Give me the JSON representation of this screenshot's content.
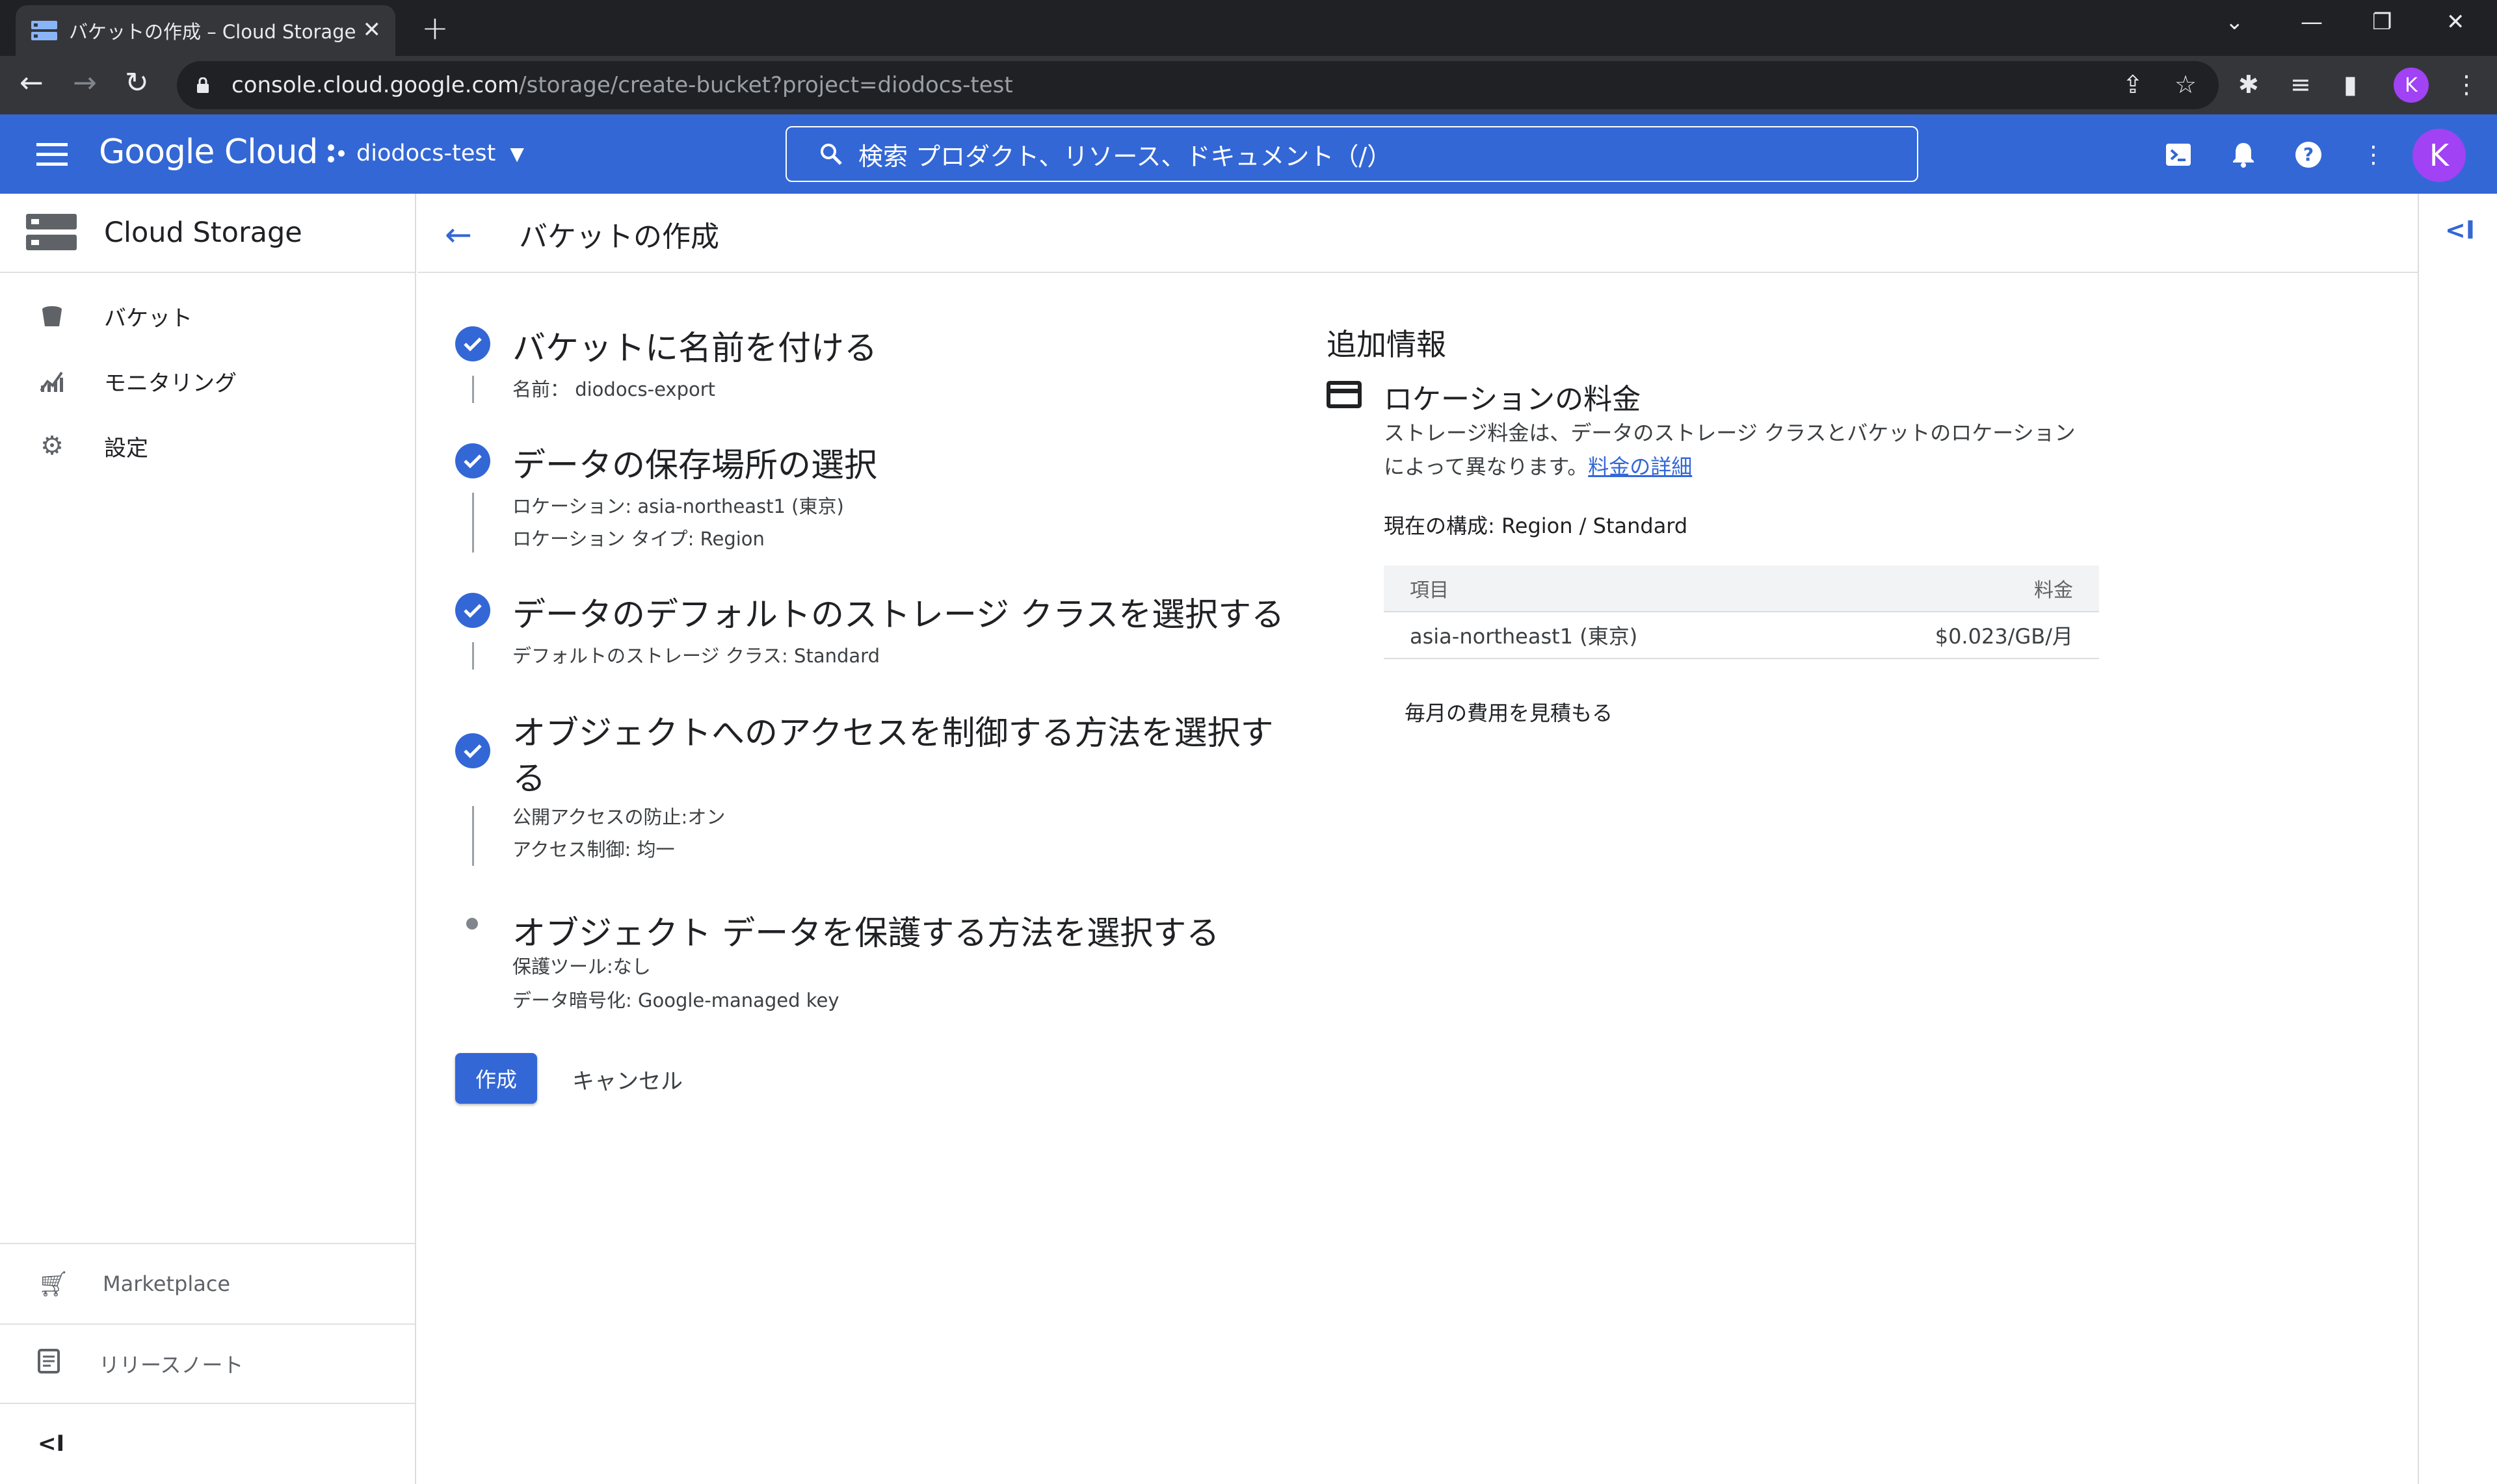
{
  "browser": {
    "tab_title": "バケットの作成 – Cloud Storage – d",
    "url_host": "console.cloud.google.com",
    "url_path": "/storage/create-bucket?project=diodocs-test",
    "profile_initial": "K"
  },
  "header": {
    "logo": "Google Cloud",
    "project": "diodocs-test",
    "search_placeholder": "検索  プロダクト、リソース、ドキュメント（/）",
    "avatar_initial": "K"
  },
  "sidebar": {
    "title": "Cloud Storage",
    "items": [
      {
        "label": "バケット",
        "icon": "bucket-icon"
      },
      {
        "label": "モニタリング",
        "icon": "monitoring-icon"
      },
      {
        "label": "設定",
        "icon": "gear-icon"
      }
    ],
    "marketplace": "Marketplace",
    "release_notes": "リリースノート"
  },
  "page": {
    "title": "バケットの作成"
  },
  "steps": [
    {
      "title": "バケットに名前を付ける",
      "details": [
        "名前： diodocs-export"
      ],
      "status": "done"
    },
    {
      "title": "データの保存場所の選択",
      "details": [
        "ロケーション: asia-northeast1 (東京)",
        "ロケーション タイプ: Region"
      ],
      "status": "done"
    },
    {
      "title": "データのデフォルトのストレージ クラスを選択する",
      "details": [
        "デフォルトのストレージ クラス: Standard"
      ],
      "status": "done"
    },
    {
      "title_line1": "オブジェクトへのアクセスを制御する方法を選択す",
      "title_line2": "る",
      "details": [
        "公開アクセスの防止:オン",
        "アクセス制御: 均一"
      ],
      "status": "done"
    },
    {
      "title": "オブジェクト データを保護する方法を選択する",
      "details": [
        "保護ツール:なし",
        "データ暗号化: Google-managed key"
      ],
      "status": "current"
    }
  ],
  "actions": {
    "create": "作成",
    "cancel": "キャンセル"
  },
  "info": {
    "title": "追加情報",
    "location_pricing_title": "ロケーションの料金",
    "desc_line1": "ストレージ料金は、データのストレージ クラスとバケットのロケーション",
    "desc_line2": "によって異なります。",
    "pricing_link": "料金の詳細",
    "current_config": "現在の構成: Region / Standard",
    "table": {
      "col_item": "項目",
      "col_price": "料金",
      "row_item": "asia-northeast1 (東京)",
      "row_price": "$0.023/GB/月"
    },
    "estimate": "毎月の費用を見積もる"
  }
}
